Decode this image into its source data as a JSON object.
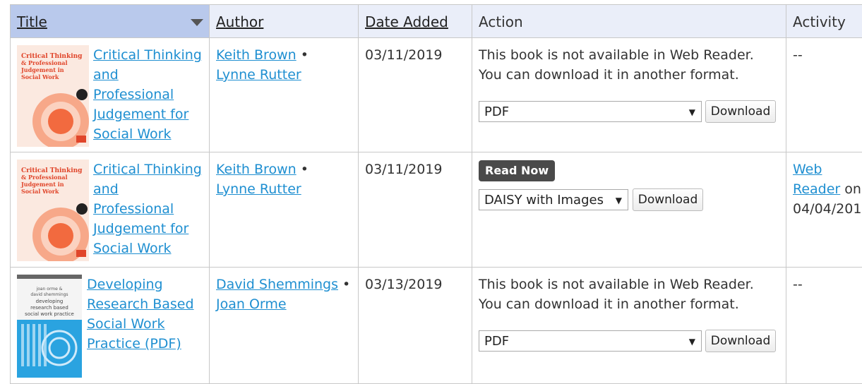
{
  "headers": {
    "title": "Title",
    "author": "Author",
    "date_added": "Date Added",
    "action": "Action",
    "activity": "Activity"
  },
  "rows": [
    {
      "cover_title": "Critical Thinking & Professional Judgement in Social Work",
      "title": "Critical Thinking and Professional Judgement for Social Work",
      "title_lines": [
        "Critical Thinking",
        "and",
        "Professional",
        "Judgement for",
        "Social Work"
      ],
      "author1": "Keith Brown",
      "author2": "Lynne Rutter",
      "date": "03/11/2019",
      "note1": "This book is not available in Web Reader.",
      "note2": "You can download it in another format.",
      "format": "PDF",
      "download": "Download",
      "activity": "--"
    },
    {
      "cover_title": "Critical Thinking & Professional Judgement in Social Work",
      "title_lines": [
        "Critical Thinking",
        "and",
        "Professional",
        "Judgement for",
        "Social Work"
      ],
      "author1": "Keith Brown",
      "author2": "Lynne Rutter",
      "date": "03/11/2019",
      "read_now": "Read Now",
      "format": "DAISY with Images",
      "download": "Download",
      "activity_link1": "Web",
      "activity_link2": "Reader",
      "activity_on": "on",
      "activity_date": "04/04/201"
    },
    {
      "cover_title": "developing research based social work practice",
      "title_lines": [
        "Developing",
        "Research Based",
        "Social Work",
        "Practice (PDF)"
      ],
      "author1": "David Shemmings",
      "author2": "Joan Orme",
      "date": "03/13/2019",
      "note1": "This book is not available in Web Reader.",
      "note2": "You can download it in another format.",
      "format": "PDF",
      "download": "Download",
      "activity": "--"
    }
  ],
  "colors": {
    "link": "#1f8fd1",
    "header_bg": "#eaeef9",
    "sorted_header_bg": "#b9c9ec",
    "read_now_bg": "#4a4a4a",
    "cover_orange": "#f26a3f"
  },
  "icons": {
    "sort": "sort-down-triangle-icon",
    "dropdown": "dropdown-caret-icon"
  }
}
